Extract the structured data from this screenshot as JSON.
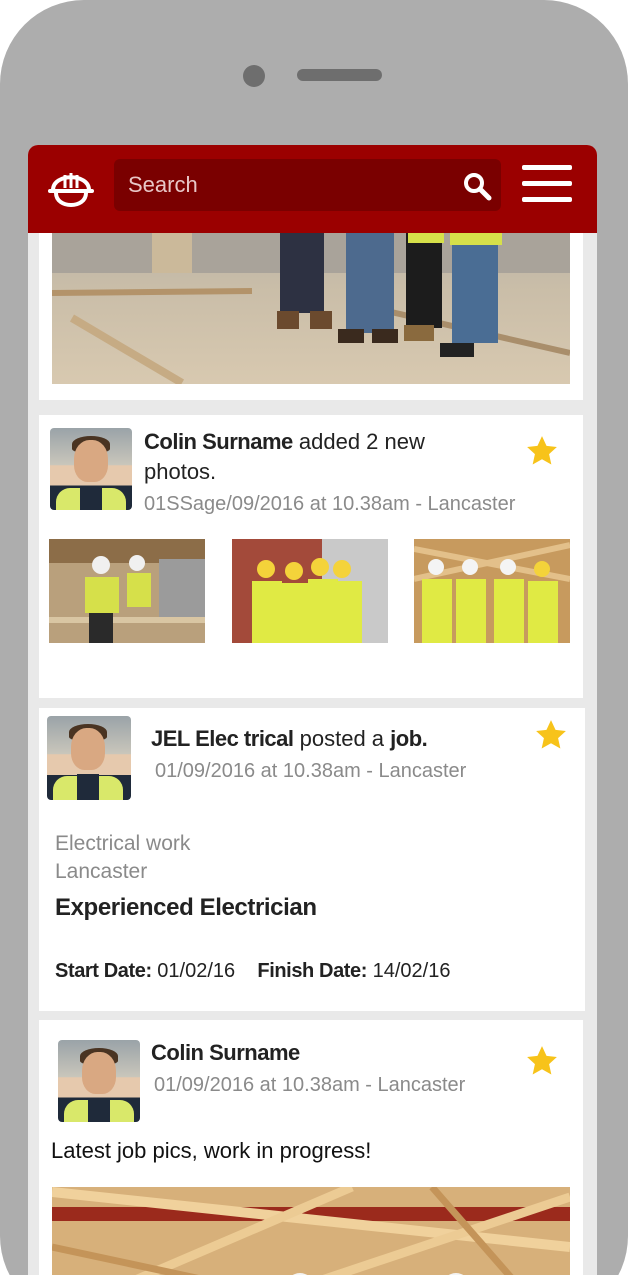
{
  "search": {
    "placeholder": "Search"
  },
  "feed": [
    {
      "author": "Colin Surname",
      "action": "added 2 new",
      "action_cont": "photos.",
      "meta": "01SSage/09/2016 at 10.38am - Lancaster"
    },
    {
      "author": "JEL Elec trical",
      "action": "posted a",
      "object": "job.",
      "meta": "01/09/2016 at 10.38am - Lancaster",
      "job": {
        "category": "Electrical work",
        "location": "Lancaster",
        "title": "Experienced Electrician",
        "start_label": "Start Date:",
        "start_value": "01/02/16",
        "finish_label": "Finish Date:",
        "finish_value": "14/02/16"
      }
    },
    {
      "author": "Colin Surname",
      "meta": "01/09/2016 at 10.38am - Lancaster",
      "text": "Latest job pics, work in progress!"
    }
  ],
  "colors": {
    "brand": "#9b0000",
    "search_bg": "#7a0000",
    "star": "#f7c31a"
  },
  "icons": [
    "hard-hat-icon",
    "search-icon",
    "hamburger-menu-icon",
    "star-icon"
  ]
}
